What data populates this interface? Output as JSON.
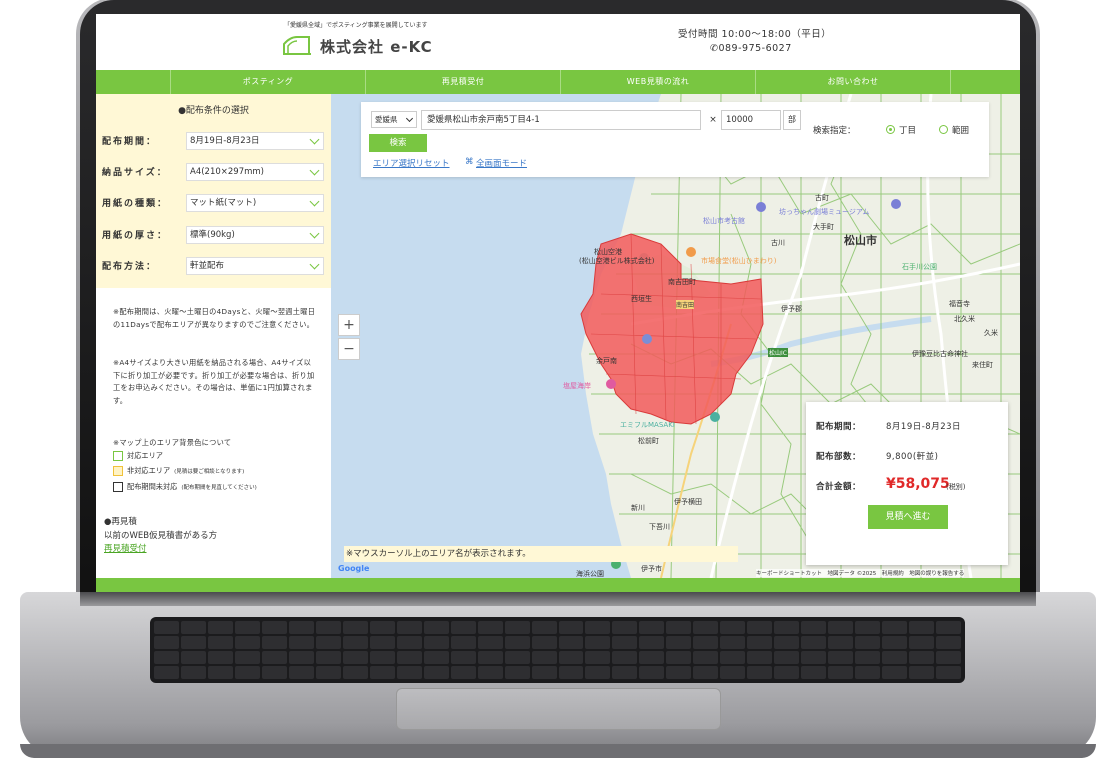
{
  "header": {
    "tagline": "「愛媛県全域」でポスティング事業を展開しています",
    "company": "株式会社 e-KC",
    "hours": "受付時間 10:00〜18:00（平日）",
    "phone": "089-975-6027"
  },
  "nav": {
    "items": [
      "ポスティング",
      "再見積受付",
      "WEB見積の流れ",
      "お問い合わせ"
    ]
  },
  "sidebar": {
    "title": "●配布条件の選択",
    "rows": [
      {
        "label": "配布期間：",
        "value": "8月19日-8月23日"
      },
      {
        "label": "納品サイズ：",
        "value": "A4(210×297mm)"
      },
      {
        "label": "用紙の種類：",
        "value": "マット紙(マット)"
      },
      {
        "label": "用紙の厚さ：",
        "value": "標準(90kg)"
      },
      {
        "label": "配布方法：",
        "value": "軒並配布"
      }
    ],
    "note1": "※配布期間は、火曜〜土曜日の4Daysと、火曜〜翌週土曜日の11Daysで配布エリアが異なりますのでご注意ください。",
    "note2": "※A4サイズより大きい用紙を納品される場合、A4サイズ以下に折り加工が必要です。折り加工が必要な場合は、折り加工をお申込みください。その場合は、単価に1円加算されます。",
    "legend_title": "※マップ上のエリア背景色について",
    "legend": [
      {
        "label": "対応エリア",
        "sub": "",
        "color": "#79c641"
      },
      {
        "label": "非対応エリア",
        "sub": "(見積は要ご相談となります)",
        "color": "#f0c23a"
      },
      {
        "label": "配布期間未対応",
        "sub": "(配布期間を見直してください)",
        "color": "#333333"
      }
    ],
    "re_title": "●再見積",
    "re_desc": "以前のWEB仮見積書がある方",
    "re_link": "再見積受付"
  },
  "search": {
    "prefecture": "愛媛県",
    "address": "愛媛県松山市余戸南5丁目4-1",
    "clear": "×",
    "quantity": "10000",
    "unit": "部",
    "button": "検索",
    "reset": "エリア選択リセット",
    "fullscreen": "全画面モード",
    "spec_label": "検索指定：",
    "options": [
      "丁目",
      "範囲"
    ]
  },
  "map": {
    "zoom_in": "+",
    "zoom_out": "−",
    "labels": [
      "松山市",
      "古町",
      "松山市考古館",
      "坊っちゃん劇場ミュージアム",
      "大手町",
      "石手川公園",
      "福音寺",
      "北久米",
      "久米",
      "南吉田町",
      "来住町",
      "伊豫豆比古命神社",
      "余戸南",
      "塩屋海岸",
      "エミフルMASAKI",
      "松前町",
      "伊予横田",
      "新川",
      "下吾川",
      "伊予市",
      "海浜公園",
      "松山空港",
      "(松山空港ビル株式会社)",
      "市場食堂(松山ひまわり)",
      "南吉田",
      "古川",
      "伊予郡",
      "西垣生",
      "松山IC"
    ],
    "hover_note": "※マウスカーソル上のエリア名が表示されます。",
    "google": "Google",
    "attribution": "キーボードショートカット　地図データ ©2025　利用規約　地図の誤りを報告する"
  },
  "info": {
    "period_label": "配布期間：",
    "period": "8月19日-8月23日",
    "count_label": "配布部数：",
    "count": "9,800(軒並)",
    "total_label": "合計金額：",
    "total": "¥58,075",
    "tax": "(税別)",
    "button": "見積へ進む"
  },
  "colors": {
    "accent": "#79c641",
    "selected_area": "#f25a5a",
    "price": "#e02929"
  }
}
